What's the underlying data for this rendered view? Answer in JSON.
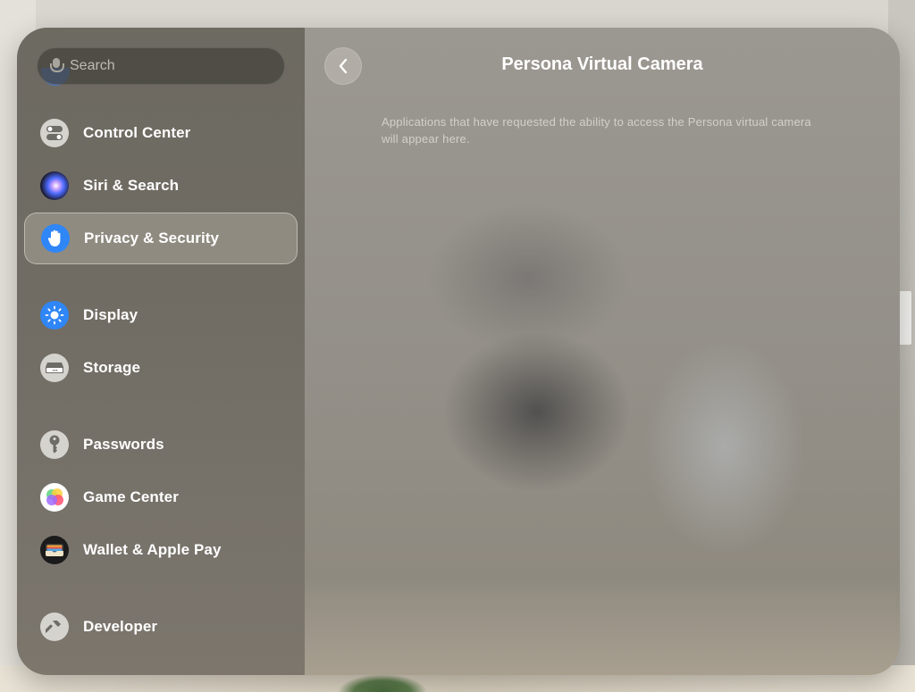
{
  "search": {
    "placeholder": "Search"
  },
  "sidebar": {
    "items": [
      {
        "label": "Control Center",
        "icon": "toggles-icon"
      },
      {
        "label": "Siri & Search",
        "icon": "siri-icon"
      },
      {
        "label": "Privacy & Security",
        "icon": "hand-icon",
        "selected": true
      },
      {
        "label": "Display",
        "icon": "sun-icon"
      },
      {
        "label": "Storage",
        "icon": "storage-icon"
      },
      {
        "label": "Passwords",
        "icon": "key-icon"
      },
      {
        "label": "Game Center",
        "icon": "game-center-icon"
      },
      {
        "label": "Wallet & Apple Pay",
        "icon": "wallet-icon"
      },
      {
        "label": "Developer",
        "icon": "hammer-icon"
      }
    ]
  },
  "main": {
    "title": "Persona Virtual Camera",
    "description": "Applications that have requested the ability to access the Persona virtual camera will appear here."
  },
  "colors": {
    "accent": "#2f86f6",
    "text": "#ffffff",
    "secondary_text": "#d3d0c9"
  }
}
